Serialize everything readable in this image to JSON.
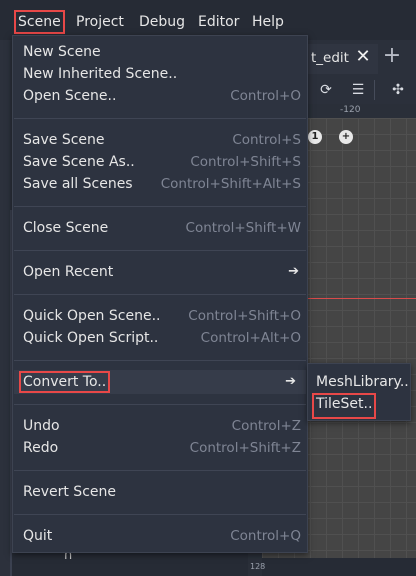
{
  "menubar": {
    "items": [
      "Scene",
      "Project",
      "Debug",
      "Editor",
      "Help"
    ]
  },
  "editor": {
    "tab_label": "t_edit",
    "ruler_h_label": "-120",
    "ruler_v_label": "128",
    "scene_tree_partial": "n",
    "viewport_icon_1": "1",
    "viewport_icon_2": "+"
  },
  "scene_menu": {
    "new_scene": {
      "label": "New Scene",
      "shortcut": ""
    },
    "new_inherited_scene": {
      "label": "New Inherited Scene..",
      "shortcut": ""
    },
    "open_scene": {
      "label": "Open Scene..",
      "shortcut": "Control+O"
    },
    "save_scene": {
      "label": "Save Scene",
      "shortcut": "Control+S"
    },
    "save_scene_as": {
      "label": "Save Scene As..",
      "shortcut": "Control+Shift+S"
    },
    "save_all_scenes": {
      "label": "Save all Scenes",
      "shortcut": "Control+Shift+Alt+S"
    },
    "close_scene": {
      "label": "Close Scene",
      "shortcut": "Control+Shift+W"
    },
    "open_recent": {
      "label": "Open Recent"
    },
    "quick_open_scene": {
      "label": "Quick Open Scene..",
      "shortcut": "Control+Shift+O"
    },
    "quick_open_script": {
      "label": "Quick Open Script..",
      "shortcut": "Control+Alt+O"
    },
    "convert_to": {
      "label": "Convert To.."
    },
    "undo": {
      "label": "Undo",
      "shortcut": "Control+Z"
    },
    "redo": {
      "label": "Redo",
      "shortcut": "Control+Shift+Z"
    },
    "revert_scene": {
      "label": "Revert Scene"
    },
    "quit": {
      "label": "Quit",
      "shortcut": "Control+Q"
    }
  },
  "convert_submenu": {
    "mesh_library": "MeshLibrary..",
    "tileset": "TileSet.."
  },
  "colors": {
    "highlight_outline": "#e84848",
    "menu_bg": "#2d3340",
    "shortcut_text": "#7f8594"
  }
}
